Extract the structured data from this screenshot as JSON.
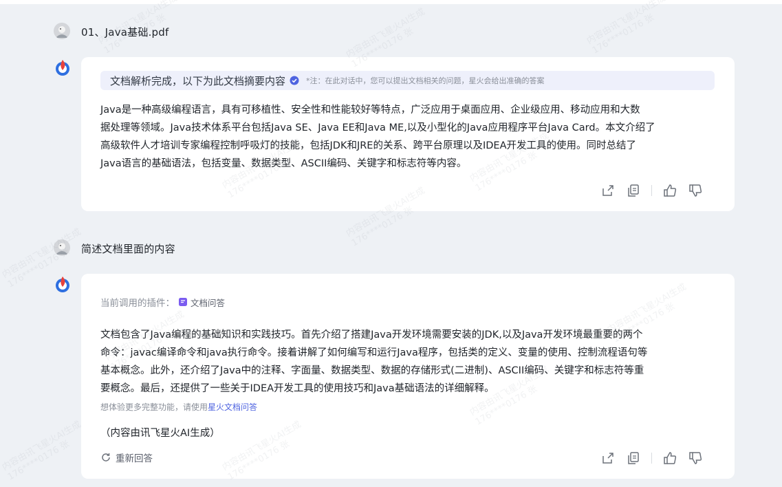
{
  "conversation": [
    {
      "user_text": "01、Java基础.pdf",
      "bot": {
        "banner_title": "文档解析完成，以下为此文档摘要内容",
        "banner_note": "*注：在此对话中，您可以提出文档相关的问题，星火会给出准确的答案",
        "lines": [
          "Java是一种高级编程语言，具有可移植性、安全性和性能较好等特点，广泛应用于桌面应用、企业级应用、移动应用和大数",
          "据处理等领域。Java技术体系平台包括Java SE、Java EE和Java ME,以及小型化的Java应用程序平台Java Card。本文介绍了",
          "高级软件人才培训专家编程控制呼吸灯的技能，包括JDK和JRE的关系、跨平台原理以及IDEA开发工具的使用。同时总结了",
          "Java语言的基础语法，包括变量、数据类型、ASCII编码、关键字和标志符等内容。"
        ]
      }
    },
    {
      "user_text": "简述文档里面的内容",
      "bot": {
        "plugin_label": "当前调用的插件：",
        "plugin_name": "文档问答",
        "lines": [
          "文档包含了Java编程的基础知识和实践技巧。首先介绍了搭建Java开发环境需要安装的JDK,以及Java开发环境最重要的两个",
          "命令：javac编译命令和java执行命令。接着讲解了如何编写和运行Java程序，包括类的定义、变量的使用、控制流程语句等",
          "基本概念。此外，还介绍了Java中的注释、字面量、数据类型、数据的存储形式(二进制)、ASCII编码、关键字和标志符等重",
          "要概念。最后，还提供了一些关于IDEA开发工具的使用技巧和Java基础语法的详细解释。"
        ],
        "hint_text": "想体验更多完整功能，请使用",
        "hint_link": "星火文档问答",
        "generated_note": "（内容由讯飞星火AI生成）",
        "regenerate_label": "重新回答"
      }
    }
  ],
  "watermark": {
    "line1": "内容由讯飞星火AI生成",
    "line2": "176****0176 张"
  },
  "colors": {
    "accent": "#4f64e0",
    "background": "#eef1f5",
    "card": "#ffffff",
    "banner": "#eef0fb"
  }
}
